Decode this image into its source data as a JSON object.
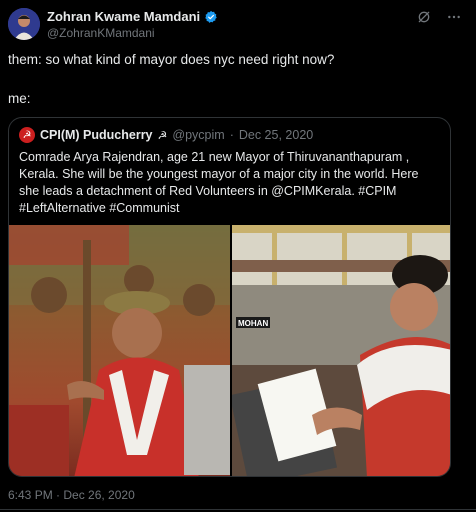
{
  "author": {
    "display_name": "Zohran Kwame Mamdani",
    "handle": "@ZohranKMamdani",
    "verified": true
  },
  "tweet": {
    "line1": "them: so what kind of mayor does nyc need right now?",
    "line2": "me:"
  },
  "quote": {
    "name": "CPI(M) Puducherry",
    "name_symbol": "☭",
    "handle": "@pycpim",
    "separator": "·",
    "date": "Dec 25, 2020",
    "text": "Comrade Arya Rajendran, age 21  new Mayor of Thiruvananthapuram , Kerala. She will be the youngest mayor of a major city in the world. Here she leads a detachment of Red Volunteers in @CPIMKerala. #CPIM  #LeftAlternative #Communist",
    "image_sign": "MOHAN"
  },
  "timestamp": "6:43 PM · Dec 26, 2020",
  "icons": {
    "avatar": "avatar",
    "verified": "verified-badge-icon",
    "grok": "grok-icon",
    "more": "more-icon",
    "quote_logo": "hammer-sickle-icon"
  },
  "colors": {
    "background": "#000000",
    "text": "#e7e9ea",
    "secondary": "#71767b",
    "verified": "#1d9bf0",
    "border": "#2f3336"
  }
}
